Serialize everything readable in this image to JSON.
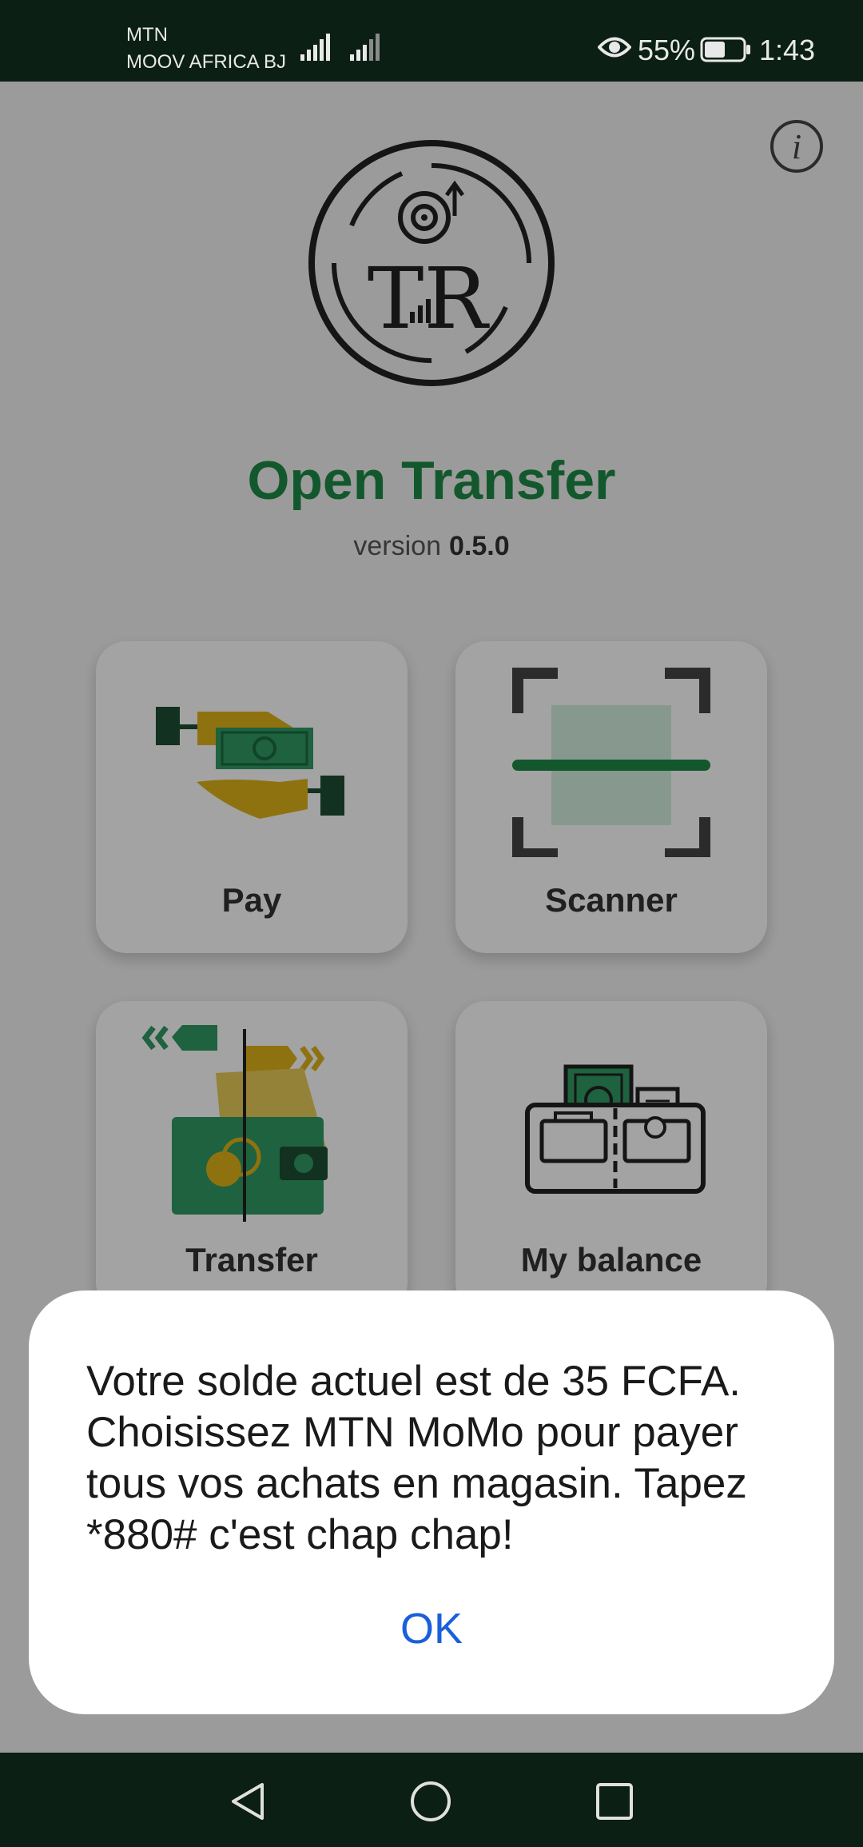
{
  "status_bar": {
    "carrier_1": "MTN",
    "carrier_2": "MOOV AFRICA BJ",
    "battery_percent": "55%",
    "battery_level": 0.55,
    "time": "1:43",
    "icons": [
      "signal-icon",
      "signal-icon",
      "eye-icon",
      "battery-icon"
    ]
  },
  "app": {
    "title": "Open Transfer",
    "version_label": "version",
    "version_number": "0.5.0",
    "brand_color": "#1f8a47",
    "logo_text": "TR",
    "info_icon": "info-icon",
    "menu": [
      {
        "label": "Pay",
        "icon": "pay-hands-money-icon"
      },
      {
        "label": "Scanner",
        "icon": "qr-scanner-icon"
      },
      {
        "label": "Transfer",
        "icon": "wallet-transfer-icon"
      },
      {
        "label": "My balance",
        "icon": "wallet-balance-icon"
      }
    ]
  },
  "dialog": {
    "message": "Votre solde actuel est de 35 FCFA. Choisissez MTN MoMo pour payer tous vos achats en magasin. Tapez *880# c'est chap chap!",
    "ok_label": "OK",
    "ok_color": "#1a5fdb"
  },
  "nav_bar": {
    "icons": [
      "back-icon",
      "home-icon",
      "recent-apps-icon"
    ]
  }
}
